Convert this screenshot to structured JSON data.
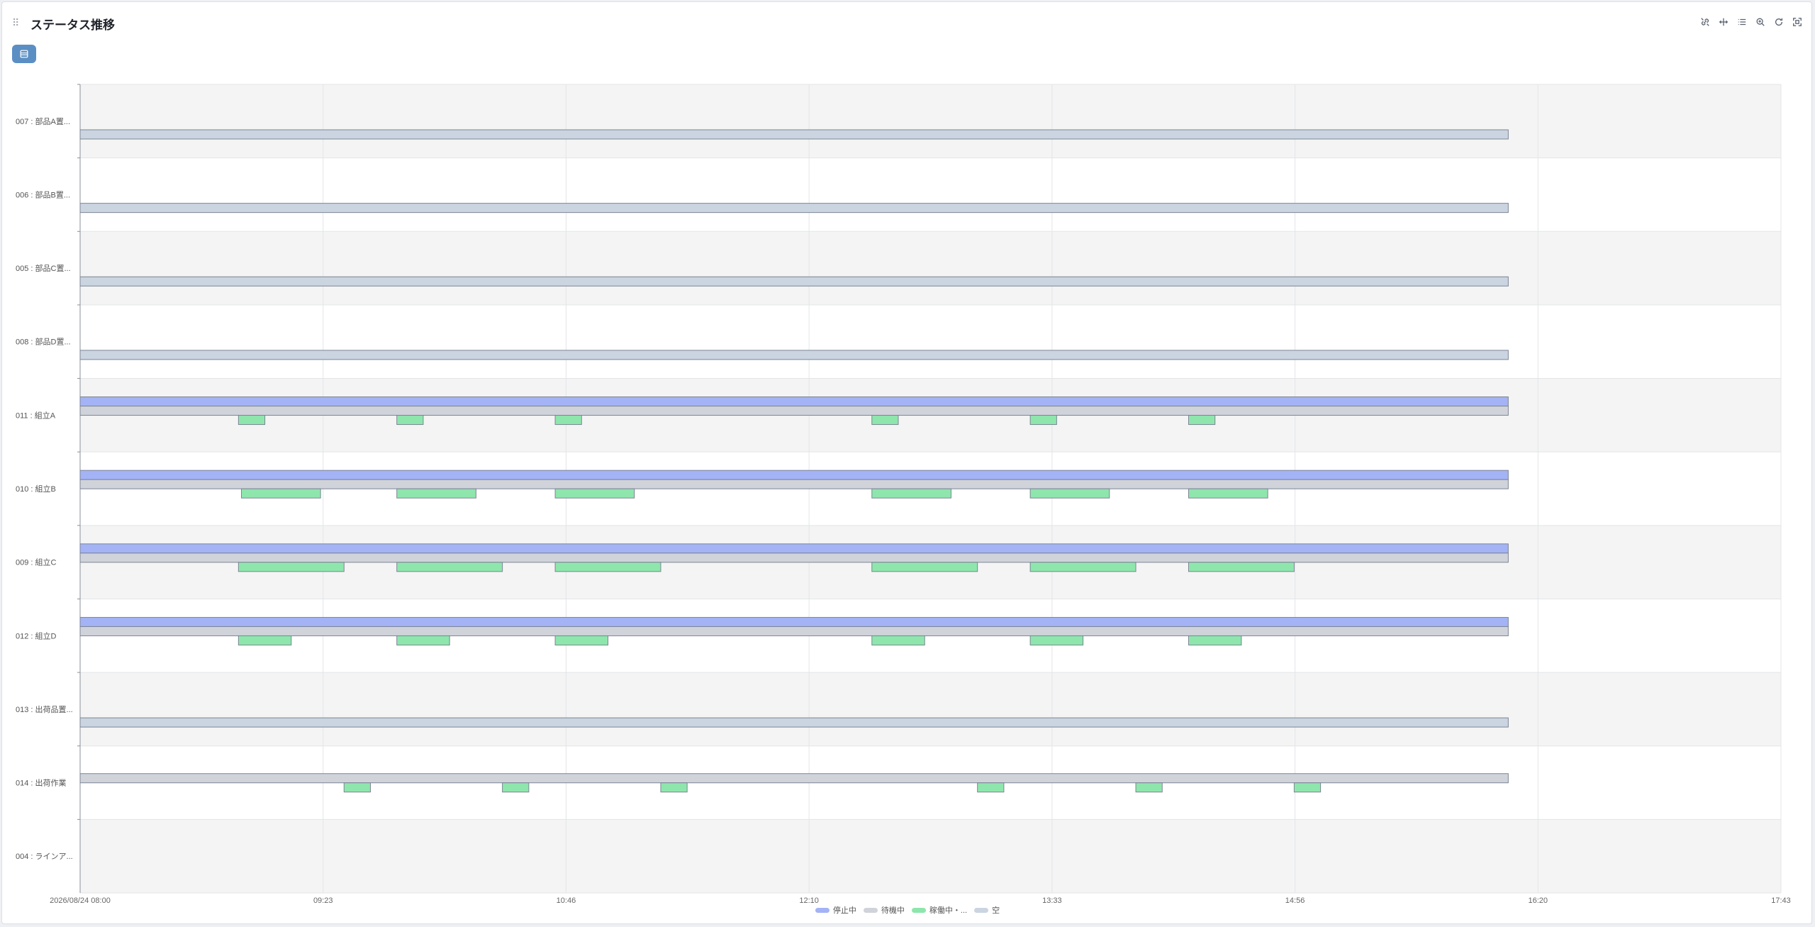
{
  "header": {
    "title": "ステータス推移"
  },
  "toolbar": {
    "icons": [
      "link-icon",
      "drag-pan-icon",
      "list-icon",
      "zoom-icon",
      "refresh-icon",
      "fullscreen-icon"
    ]
  },
  "colors": {
    "stopped": "#a3b3f5",
    "waiting": "#d0d3da",
    "running": "#8ee6ad",
    "empty": "#cbd5e1",
    "stroke": "#7c8594",
    "band_alt": "#f4f4f4",
    "band": "#ffffff",
    "accent": "#5b8fc4"
  },
  "chart_data": {
    "type": "timeline",
    "x_ticks": [
      "2026/08/24 08:00",
      "09:23",
      "10:46",
      "12:10",
      "13:33",
      "14:56",
      "16:20",
      "17:43"
    ],
    "x_range_hours": [
      0,
      580
    ],
    "rows": [
      {
        "label": "007 : 部品A置...",
        "bars": [
          {
            "status": "empty",
            "start": 0,
            "end": 487
          }
        ]
      },
      {
        "label": "006 : 部品B置...",
        "bars": [
          {
            "status": "empty",
            "start": 0,
            "end": 487
          }
        ]
      },
      {
        "label": "005 : 部品C置...",
        "bars": [
          {
            "status": "empty",
            "start": 0,
            "end": 487
          }
        ]
      },
      {
        "label": "008 : 部品D置...",
        "bars": [
          {
            "status": "empty",
            "start": 0,
            "end": 487
          }
        ]
      },
      {
        "label": "011 : 組立A",
        "bars": [
          {
            "status": "stopped",
            "start": 0,
            "end": 487
          },
          {
            "status": "waiting",
            "start": 0,
            "end": 487
          },
          {
            "status": "running",
            "start": 54,
            "end": 63
          },
          {
            "status": "running",
            "start": 108,
            "end": 117
          },
          {
            "status": "running",
            "start": 162,
            "end": 171
          },
          {
            "status": "running",
            "start": 270,
            "end": 279
          },
          {
            "status": "running",
            "start": 324,
            "end": 333
          },
          {
            "status": "running",
            "start": 378,
            "end": 387
          }
        ]
      },
      {
        "label": "010 : 組立B",
        "bars": [
          {
            "status": "stopped",
            "start": 0,
            "end": 487
          },
          {
            "status": "waiting",
            "start": 0,
            "end": 487
          },
          {
            "status": "running",
            "start": 55,
            "end": 82
          },
          {
            "status": "running",
            "start": 108,
            "end": 135
          },
          {
            "status": "running",
            "start": 162,
            "end": 189
          },
          {
            "status": "running",
            "start": 270,
            "end": 297
          },
          {
            "status": "running",
            "start": 324,
            "end": 351
          },
          {
            "status": "running",
            "start": 378,
            "end": 405
          }
        ]
      },
      {
        "label": "009 : 組立C",
        "bars": [
          {
            "status": "stopped",
            "start": 0,
            "end": 487
          },
          {
            "status": "waiting",
            "start": 0,
            "end": 487
          },
          {
            "status": "running",
            "start": 54,
            "end": 90
          },
          {
            "status": "running",
            "start": 108,
            "end": 144
          },
          {
            "status": "running",
            "start": 162,
            "end": 198
          },
          {
            "status": "running",
            "start": 270,
            "end": 306
          },
          {
            "status": "running",
            "start": 324,
            "end": 360
          },
          {
            "status": "running",
            "start": 378,
            "end": 414
          }
        ]
      },
      {
        "label": "012 : 組立D",
        "bars": [
          {
            "status": "stopped",
            "start": 0,
            "end": 487
          },
          {
            "status": "waiting",
            "start": 0,
            "end": 487
          },
          {
            "status": "running",
            "start": 54,
            "end": 72
          },
          {
            "status": "running",
            "start": 108,
            "end": 126
          },
          {
            "status": "running",
            "start": 162,
            "end": 180
          },
          {
            "status": "running",
            "start": 270,
            "end": 288
          },
          {
            "status": "running",
            "start": 324,
            "end": 342
          },
          {
            "status": "running",
            "start": 378,
            "end": 396
          }
        ]
      },
      {
        "label": "013 : 出荷品置...",
        "bars": [
          {
            "status": "empty",
            "start": 0,
            "end": 487
          }
        ]
      },
      {
        "label": "014 : 出荷作業",
        "bars": [
          {
            "status": "waiting",
            "start": 0,
            "end": 487
          },
          {
            "status": "running",
            "start": 90,
            "end": 99
          },
          {
            "status": "running",
            "start": 144,
            "end": 153
          },
          {
            "status": "running",
            "start": 198,
            "end": 207
          },
          {
            "status": "running",
            "start": 306,
            "end": 315
          },
          {
            "status": "running",
            "start": 360,
            "end": 369
          },
          {
            "status": "running",
            "start": 414,
            "end": 423
          }
        ]
      },
      {
        "label": "004 : ラインア...",
        "bars": []
      }
    ],
    "legend": [
      {
        "key": "stopped",
        "label": "停止中"
      },
      {
        "key": "waiting",
        "label": "待機中"
      },
      {
        "key": "running",
        "label": "稼働中・..."
      },
      {
        "key": "empty",
        "label": "空"
      }
    ],
    "grid": true,
    "legend_position": "bottom"
  }
}
